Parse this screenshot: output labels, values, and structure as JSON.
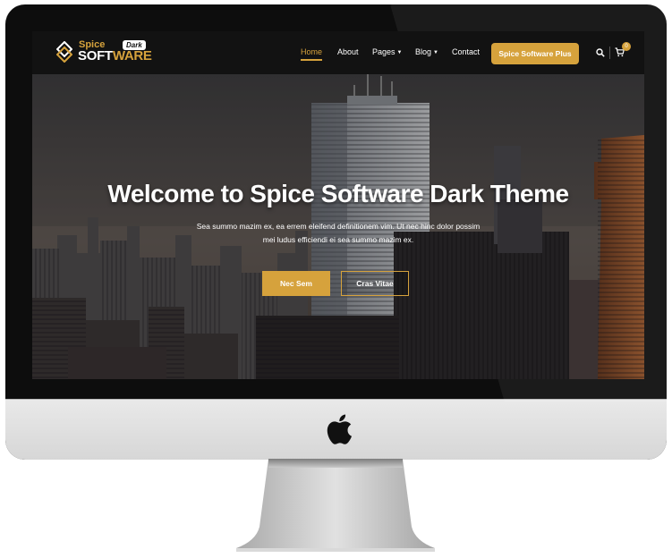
{
  "brand": {
    "logo_top": "Spice",
    "logo_main": "SOFT",
    "logo_main_accent": "WARE",
    "badge": "Dark"
  },
  "nav": {
    "items": [
      {
        "label": "Home",
        "active": true
      },
      {
        "label": "About",
        "active": false
      },
      {
        "label": "Pages",
        "active": false,
        "dropdown": true
      },
      {
        "label": "Blog",
        "active": false,
        "dropdown": true
      },
      {
        "label": "Contact",
        "active": false
      }
    ],
    "cta_label": "Spice Software Plus",
    "cart_count": "0",
    "icons": [
      "search-icon",
      "cart-icon"
    ]
  },
  "hero": {
    "title": "Welcome to Spice Software Dark Theme",
    "subtitle_line1": "Sea summo mazim ex, ea errem eleifend definitionem vim. Ut nec hinc dolor possim",
    "subtitle_line2": "mei ludus efficiendi ei sea summo mazim ex.",
    "primary_button": "Nec Sem",
    "secondary_button": "Cras Vitae"
  },
  "colors": {
    "accent": "#d6a23c",
    "navbar_bg": "#121212",
    "bezel": "#0d0d0d",
    "chin": "#dedede"
  }
}
